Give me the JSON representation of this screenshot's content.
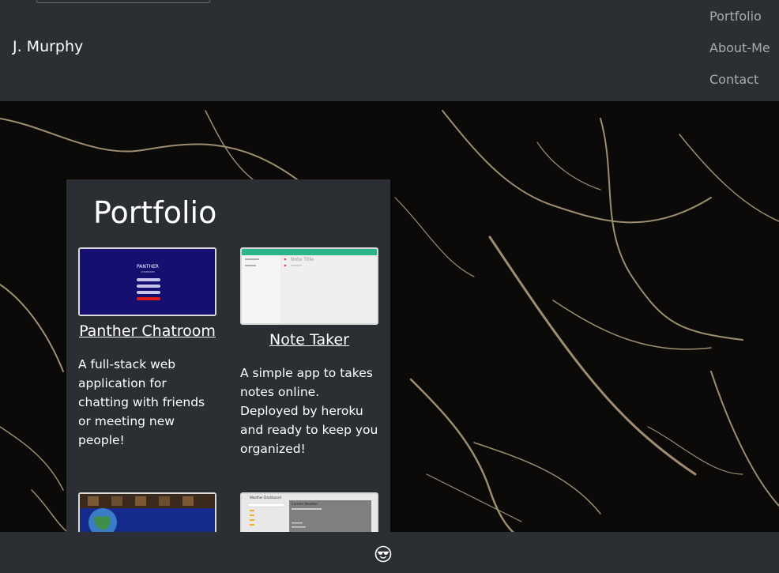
{
  "brand": "J. Murphy",
  "nav": {
    "links": [
      "Portfolio",
      "About-Me",
      "Contact"
    ]
  },
  "portfolio": {
    "title": "Portfolio",
    "projects": [
      {
        "title": "Panther Chatroom",
        "description": "A full-stack web application for chatting with friends or meeting new people!",
        "thumbnail_texts": [
          "PANTHER",
          "CHATROOM"
        ]
      },
      {
        "title": "Note Taker",
        "description": "A simple app to takes notes online. Deployed by heroku and ready to keep you organized!",
        "thumbnail_texts": [
          "Note Title"
        ]
      },
      {
        "title": "",
        "description": "",
        "thumbnail_texts": []
      },
      {
        "title": "",
        "description": "",
        "thumbnail_texts": [
          "Weather Dashboard",
          "Current Weather"
        ]
      }
    ]
  },
  "footer": {
    "icon": "sunglasses-emoji-icon"
  },
  "colors": {
    "navbar_bg": "#2b2e33",
    "panel_bg": "#2b2e33",
    "text": "#ffffff",
    "nav_link": "#a8acb1",
    "panther_thumb_bg": "#151070",
    "note_header": "#2db48b"
  }
}
